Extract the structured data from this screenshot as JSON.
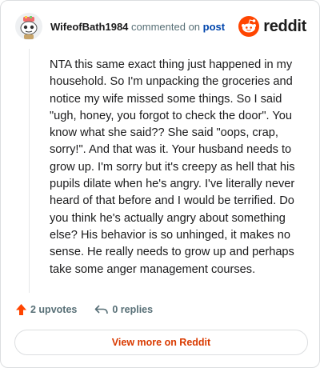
{
  "comment": {
    "username": "WifeofBath1984",
    "action_text": "commented on",
    "target_text": "post",
    "body": "NTA this same exact thing just happened in my household. So I'm unpacking the groceries and notice my wife missed some things. So I said \"ugh, honey, you forgot to check the door\". You know what she said?? She said \"oops, crap, sorry!\". And that was it. Your husband needs to grow up. I'm sorry but it's creepy as hell that his pupils dilate when he's angry. I've literally never heard of that before and I would be terrified. Do you think he's actually angry about something else? His behavior is so unhinged, it makes no sense. He really needs to grow up and perhaps take some anger management courses."
  },
  "brand": {
    "name": "reddit",
    "icon": "reddit-snoo-icon",
    "color": "#ff4500"
  },
  "actions": {
    "upvotes_label": "2 upvotes",
    "upvote_icon": "upvote-arrow-icon",
    "replies_label": "0 replies",
    "reply_icon": "reply-arrow-icon"
  },
  "footer": {
    "view_more_label": "View more on Reddit"
  },
  "colors": {
    "accent": "#d93a00",
    "link": "#0045ac",
    "muted": "#576f76"
  }
}
